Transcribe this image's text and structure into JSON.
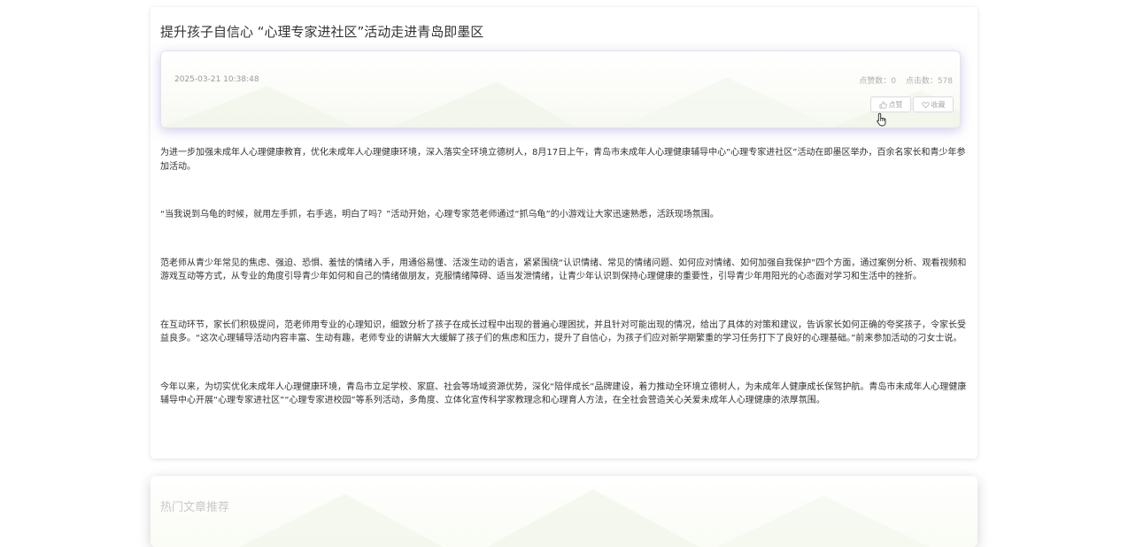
{
  "article": {
    "title": "提升孩子自信心 “心理专家进社区”活动走进青岛即墨区",
    "date": "2025-03-21 10:38:48",
    "likes_label": "点赞数：0",
    "clicks_label": "点击数：578",
    "like_button": "点赞",
    "favorite_button": "收藏",
    "paragraphs": [
      "为进一步加强未成年人心理健康教育，优化未成年人心理健康环境，深入落实全环境立德树人，8月17日上午，青岛市未成年人心理健康辅导中心“心理专家进社区”活动在即墨区举办，百余名家长和青少年参加活动。",
      "“当我说到乌龟的时候，就用左手抓，右手逃，明白了吗？”活动开始，心理专家范老师通过“抓乌龟”的小游戏让大家迅速熟悉，活跃现场氛围。",
      "范老师从青少年常见的焦虑、强迫、恐惧、羞怯的情绪入手，用通俗易懂、活泼生动的语言，紧紧围绕“认识情绪、常见的情绪问题、如何应对情绪、如何加强自我保护”四个方面，通过案例分析、观看视频和游戏互动等方式，从专业的角度引导青少年如何和自己的情绪做朋友，克服情绪障碍、适当发泄情绪，让青少年认识到保持心理健康的重要性，引导青少年用阳光的心态面对学习和生活中的挫折。",
      "在互动环节，家长们积极提问，范老师用专业的心理知识，细致分析了孩子在成长过程中出现的普遍心理困扰，并且针对可能出现的情况，给出了具体的对策和建议，告诉家长如何正确的夸奖孩子，令家长受益良多。“这次心理辅导活动内容丰富、生动有趣，老师专业的讲解大大缓解了孩子们的焦虑和压力，提升了自信心，为孩子们应对新学期繁重的学习任务打下了良好的心理基础。”前来参加活动的刁女士说。",
      "今年以来，为切实优化未成年人心理健康环境，青岛市立足学校、家庭、社会等场域资源优势，深化“陪伴成长”品牌建设，着力推动全环境立德树人，为未成年人健康成长保驾护航。青岛市未成年人心理健康辅导中心开展“心理专家进社区”“心理专家进校园”等系列活动，多角度、立体化宣传科学家教理念和心理育人方法，在全社会营造关心关爱未成年人心理健康的浓厚氛围。"
    ]
  },
  "hot": {
    "title": "热门文章推荐"
  },
  "icons": {
    "like": "thumbs-up-icon",
    "favorite": "heart-icon",
    "cursor": "hand-pointer-icon"
  },
  "colors": {
    "meta_shadow": "#786ec8",
    "muted_text": "#9a9a9a"
  }
}
